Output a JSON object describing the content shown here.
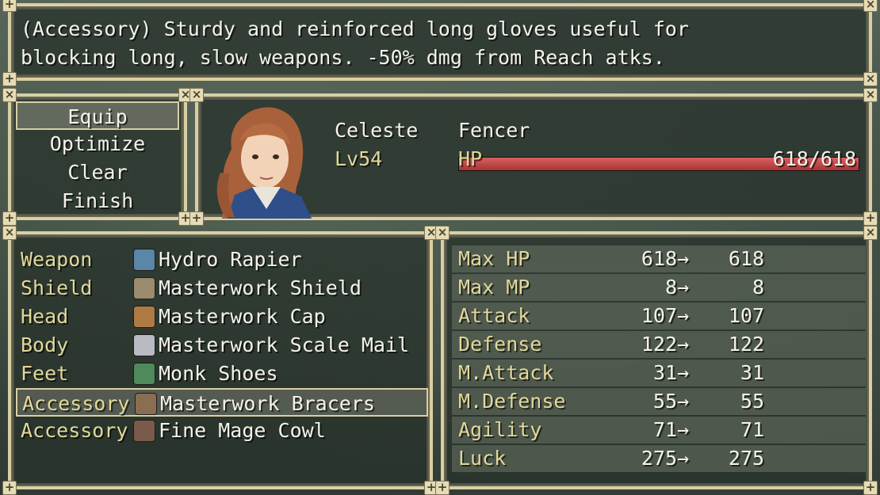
{
  "help": {
    "line1": "(Accessory) Sturdy and reinforced long gloves useful for",
    "line2": "blocking long, slow weapons. -50% dmg from Reach atks."
  },
  "commands": [
    {
      "label": "Equip",
      "selected": true
    },
    {
      "label": "Optimize"
    },
    {
      "label": "Clear"
    },
    {
      "label": "Finish"
    }
  ],
  "actor": {
    "name": "Celeste",
    "class": "Fencer",
    "level": "Lv54",
    "hp_label": "HP",
    "hp_text": "618/618",
    "hp_fraction": 1.0
  },
  "slots": [
    {
      "slot": "Weapon",
      "item": "Hydro Rapier",
      "icon": "rapier-icon",
      "color": "#5a86a8"
    },
    {
      "slot": "Shield",
      "item": "Masterwork Shield",
      "icon": "shield-icon",
      "color": "#9a8a6e"
    },
    {
      "slot": "Head",
      "item": "Masterwork Cap",
      "icon": "cap-icon",
      "color": "#b07a44"
    },
    {
      "slot": "Body",
      "item": "Masterwork Scale Mail",
      "icon": "scale-mail-icon",
      "color": "#b8bcc2"
    },
    {
      "slot": "Feet",
      "item": "Monk Shoes",
      "icon": "shoes-icon",
      "color": "#4f8a5a"
    },
    {
      "slot": "Accessory",
      "item": "Masterwork Bracers",
      "icon": "bracers-icon",
      "color": "#8a6e52",
      "selected": true
    },
    {
      "slot": "Accessory",
      "item": "Fine Mage Cowl",
      "icon": "cowl-icon",
      "color": "#7a5a4a"
    }
  ],
  "params": [
    {
      "name": "Max HP",
      "current": "618",
      "arrow": "→",
      "new": "618"
    },
    {
      "name": "Max MP",
      "current": "8",
      "arrow": "→",
      "new": "8"
    },
    {
      "name": "Attack",
      "current": "107",
      "arrow": "→",
      "new": "107"
    },
    {
      "name": "Defense",
      "current": "122",
      "arrow": "→",
      "new": "122"
    },
    {
      "name": "M.Attack",
      "current": "31",
      "arrow": "→",
      "new": "31"
    },
    {
      "name": "M.Defense",
      "current": "55",
      "arrow": "→",
      "new": "55"
    },
    {
      "name": "Agility",
      "current": "71",
      "arrow": "→",
      "new": "71"
    },
    {
      "name": "Luck",
      "current": "275",
      "arrow": "→",
      "new": "275"
    }
  ],
  "colors": {
    "frame": "#d8cfa6",
    "label": "#e0d89a",
    "text": "#f4f2ea",
    "hp_bar": "#c04848"
  }
}
